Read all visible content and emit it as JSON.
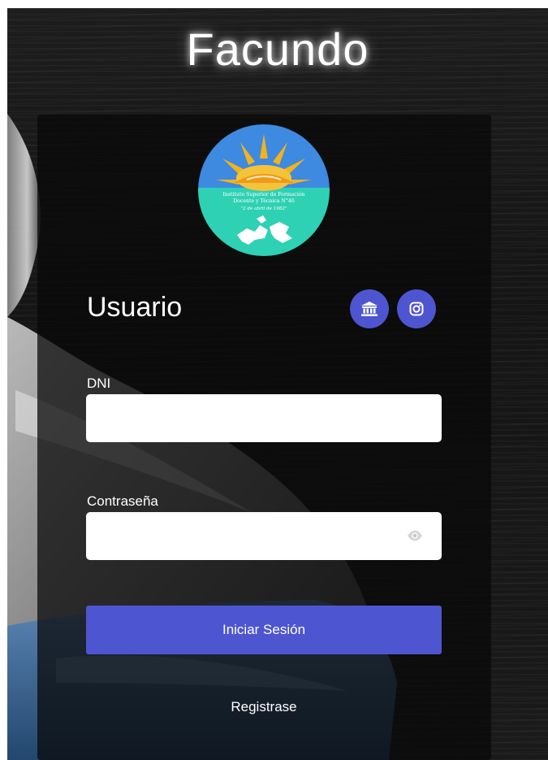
{
  "app": {
    "title": "Facundo"
  },
  "logo": {
    "lines": [
      "Instituto Superior de Formación",
      "Docente y Técnica N°46",
      "\"2 de abril de 1982\""
    ]
  },
  "login": {
    "heading": "Usuario",
    "dni_label": "DNI",
    "dni_value": "",
    "password_label": "Contraseña",
    "password_value": "",
    "submit_label": "Iniciar Sesión",
    "register_label": "Registrase"
  },
  "social": {
    "institution_icon": "institution-icon",
    "instagram_icon": "instagram-icon"
  },
  "colors": {
    "accent": "#4e55d0",
    "panel": "#0b0b0b",
    "logo_sky": "#3d8ae0",
    "logo_sea": "#2ed1b4",
    "logo_sun": "#f5b21a"
  }
}
